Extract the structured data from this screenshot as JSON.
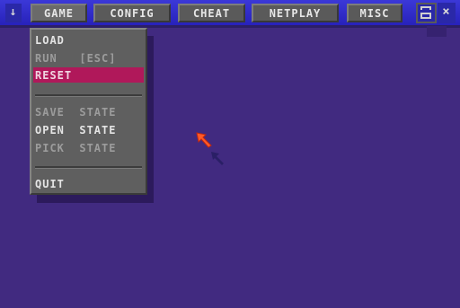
{
  "menubar": {
    "arrow_glyph": "↓",
    "items": [
      {
        "label": "GAME"
      },
      {
        "label": "CONFIG"
      },
      {
        "label": "CHEAT"
      },
      {
        "label": "NETPLAY"
      },
      {
        "label": "MISC"
      }
    ],
    "close_glyph": "×"
  },
  "game_menu": {
    "items": [
      {
        "label": "LOAD"
      },
      {
        "label": "RUN   [ESC]"
      },
      {
        "label": "RESET"
      },
      {
        "label": "SAVE  STATE"
      },
      {
        "label": "OPEN  STATE"
      },
      {
        "label": "PICK  STATE"
      },
      {
        "label": "QUIT"
      }
    ]
  },
  "colors": {
    "desktop": "#412a80",
    "menubar": "#2a28b8",
    "selection": "#b0185a",
    "cursor_primary": "#ff5a28",
    "cursor_secondary": "#2a1f66"
  }
}
